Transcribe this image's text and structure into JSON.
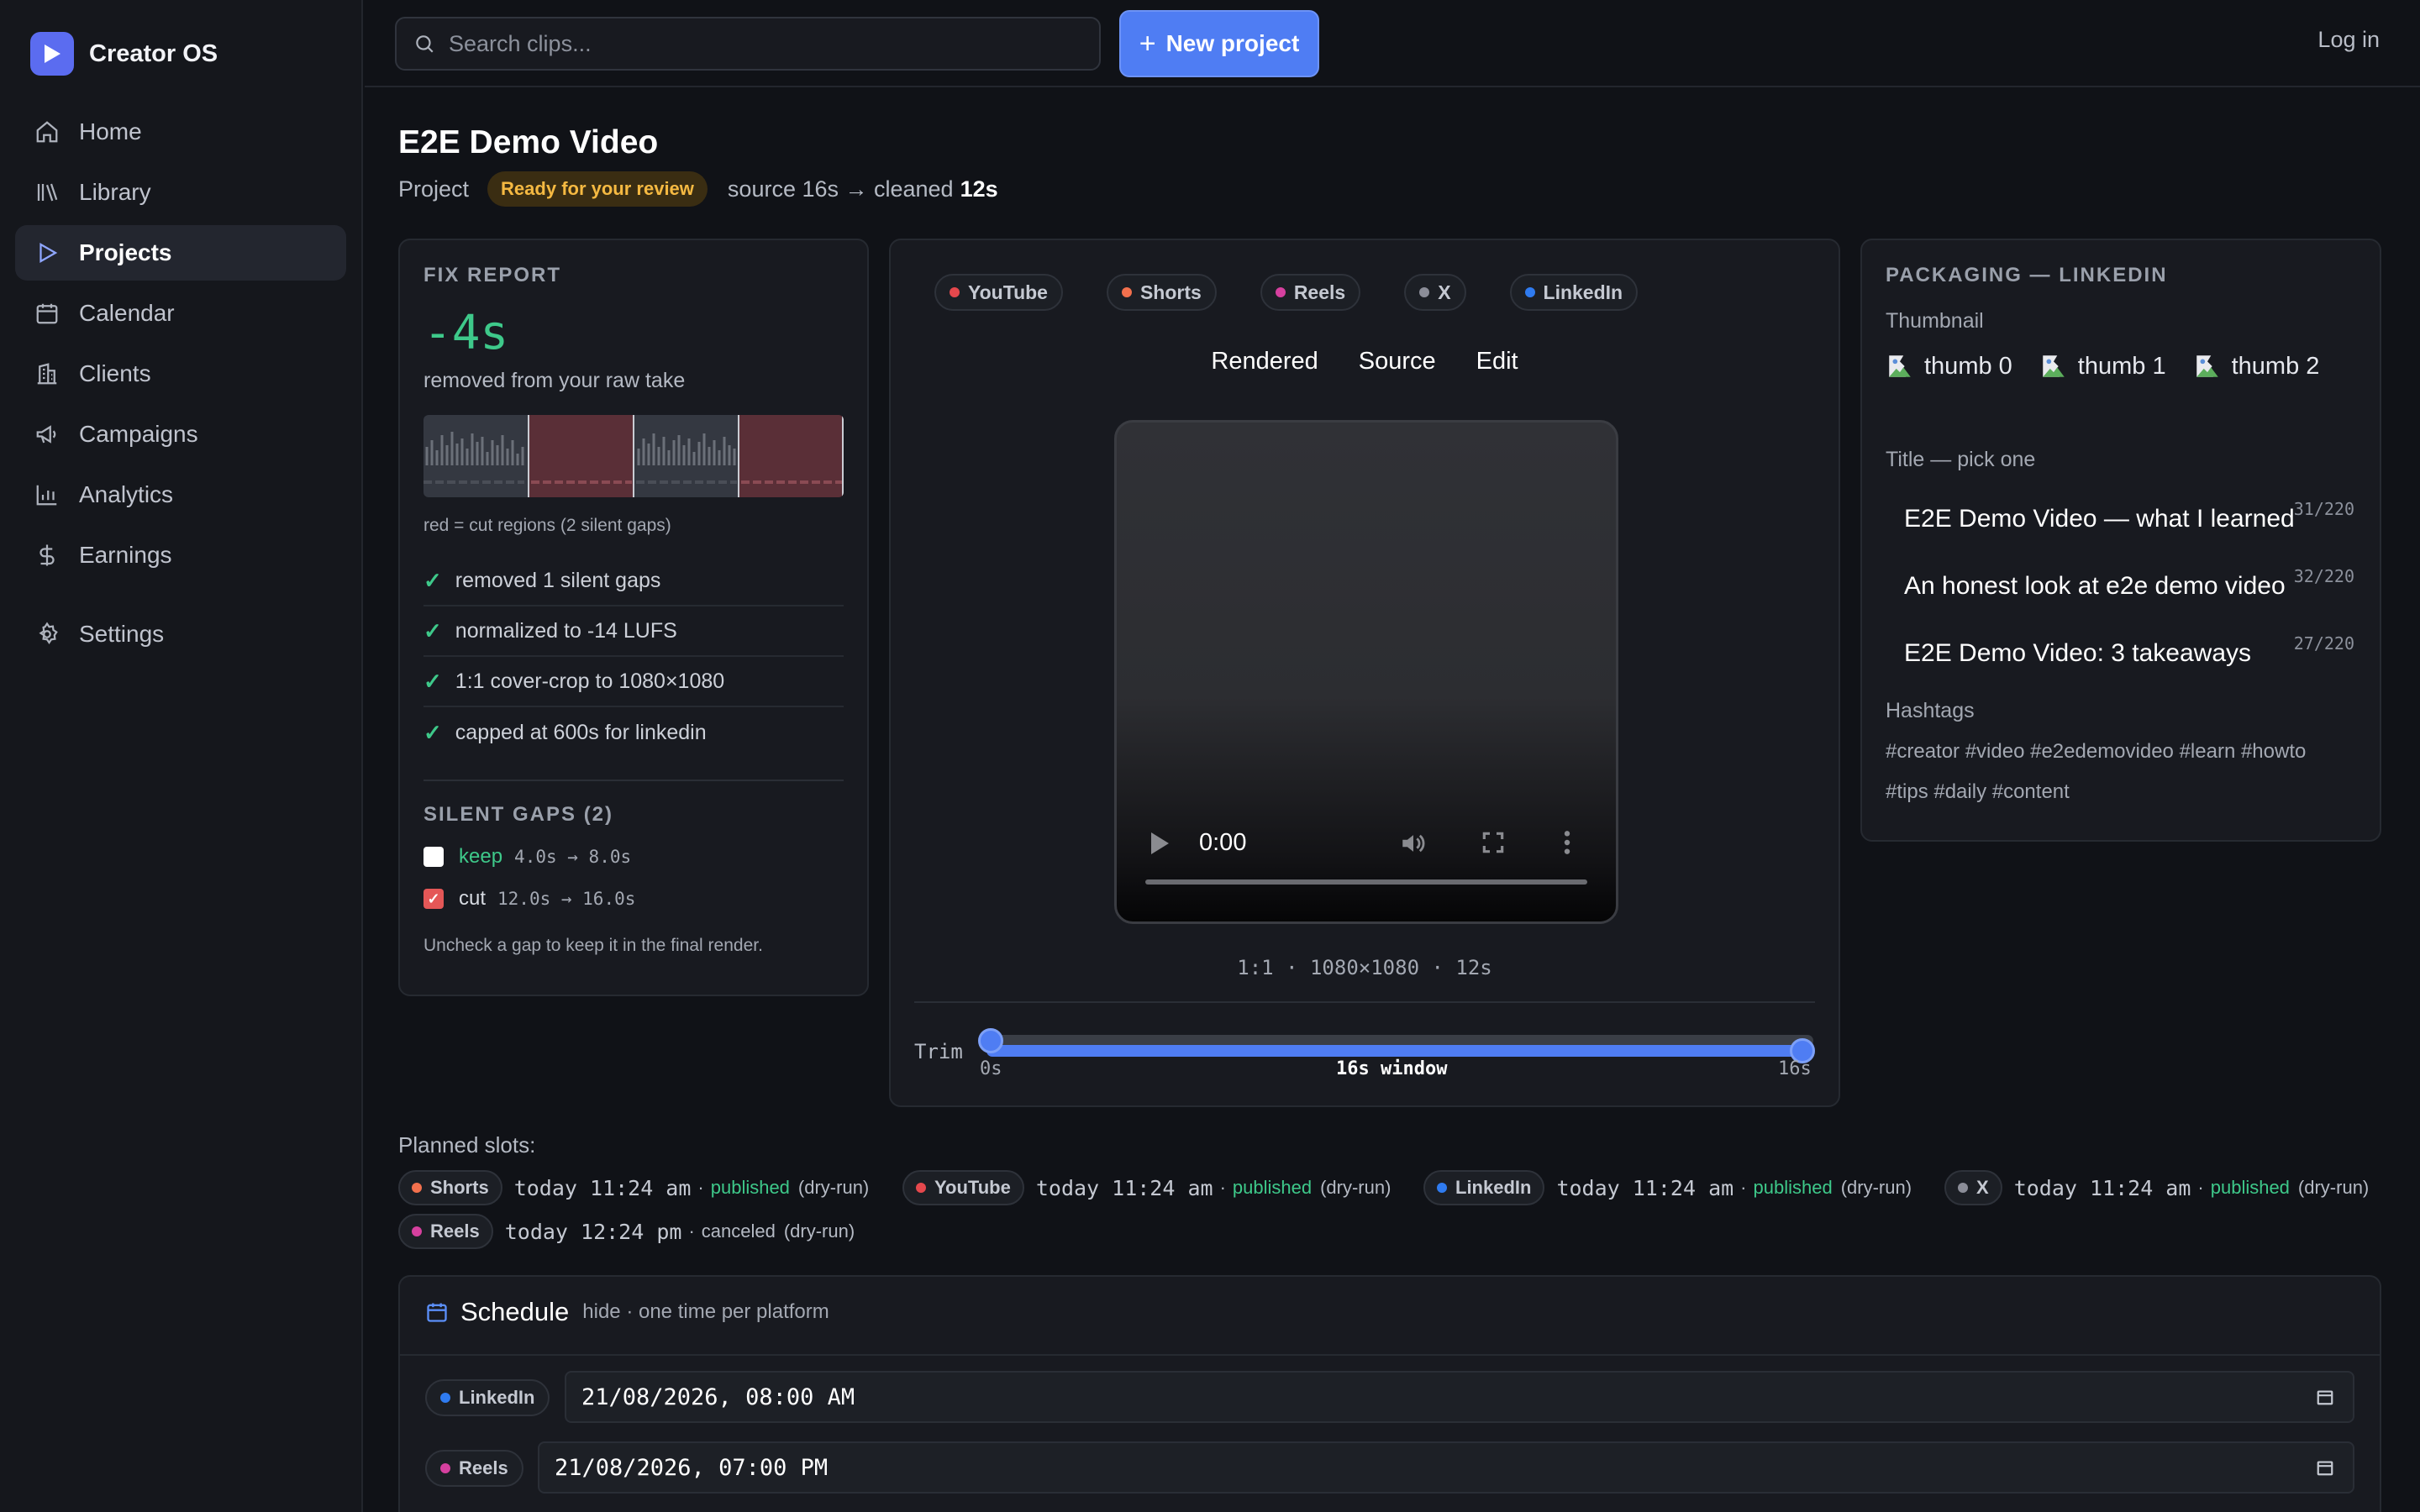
{
  "app": {
    "name": "Creator OS"
  },
  "nav": {
    "home": "Home",
    "library": "Library",
    "projects": "Projects",
    "calendar": "Calendar",
    "clients": "Clients",
    "campaigns": "Campaigns",
    "analytics": "Analytics",
    "earnings": "Earnings",
    "settings": "Settings",
    "active": "Projects"
  },
  "topbar": {
    "search_placeholder": "Search clips...",
    "new_project": "New project",
    "login": "Log in"
  },
  "project": {
    "title": "E2E Demo Video",
    "kind": "Project",
    "status": "Ready for your review",
    "duration_text": "source 16s → cleaned",
    "cleaned": "12s"
  },
  "fix_report": {
    "heading": "FIX REPORT",
    "delta": "-4s",
    "delta_sub": "removed from your raw take",
    "wave_caption": "red = cut regions (2 silent gaps)",
    "checks": [
      "removed 1 silent gaps",
      "normalized to -14 LUFS",
      "1:1 cover-crop to 1080×1080",
      "capped at 600s for linkedin"
    ],
    "gaps_heading": "SILENT GAPS (2)",
    "gaps": [
      {
        "state": "keep",
        "range": "4.0s → 8.0s",
        "checked": false
      },
      {
        "state": "cut",
        "range": "12.0s → 16.0s",
        "checked": true
      }
    ],
    "gap_note": "Uncheck a gap to keep it in the final render."
  },
  "video": {
    "platforms": [
      {
        "name": "YouTube",
        "color": "#e5484d"
      },
      {
        "name": "Shorts",
        "color": "#f2704d"
      },
      {
        "name": "Reels",
        "color": "#d6409f"
      },
      {
        "name": "X",
        "color": "#8b8d98"
      },
      {
        "name": "LinkedIn",
        "color": "#2f7bf0"
      }
    ],
    "tabs": [
      "Rendered",
      "Source",
      "Edit"
    ],
    "player_time": "0:00",
    "caption": "1:1 · 1080×1080 · 12s",
    "trim_label": "Trim",
    "trim_start": "0s",
    "trim_window": "16s window",
    "trim_end": "16s"
  },
  "packaging": {
    "heading": "PACKAGING — LINKEDIN",
    "thumb_label": "Thumbnail",
    "thumbs": [
      "thumb 0",
      "thumb 1",
      "thumb 2"
    ],
    "title_label": "Title — pick one",
    "titles": [
      {
        "text": "E2E Demo Video — what I learned",
        "count": "31/220"
      },
      {
        "text": "An honest look at e2e demo video",
        "count": "32/220"
      },
      {
        "text": "E2E Demo Video: 3 takeaways",
        "count": "27/220"
      }
    ],
    "hashtags_label": "Hashtags",
    "hashtags_line1": "#creator #video #e2edemovideo #learn #howto",
    "hashtags_line2": "#tips #daily #content"
  },
  "planned": {
    "label": "Planned slots:",
    "slots": [
      {
        "platform": "Shorts",
        "color": "#f2704d",
        "when": "today 11:24 am",
        "status": "published",
        "note": "(dry-run)"
      },
      {
        "platform": "YouTube",
        "color": "#e5484d",
        "when": "today 11:24 am",
        "status": "published",
        "note": "(dry-run)"
      },
      {
        "platform": "LinkedIn",
        "color": "#2f7bf0",
        "when": "today 11:24 am",
        "status": "published",
        "note": "(dry-run)"
      },
      {
        "platform": "X",
        "color": "#8b8d98",
        "when": "today 11:24 am",
        "status": "published",
        "note": "(dry-run)"
      },
      {
        "platform": "Reels",
        "color": "#d6409f",
        "when": "today 12:24 pm",
        "status": "canceled",
        "note": "(dry-run)"
      }
    ]
  },
  "schedule": {
    "title": "Schedule",
    "subtitle": "hide · one time per platform",
    "rows": [
      {
        "platform": "LinkedIn",
        "color": "#2f7bf0",
        "value": "21/08/2026, 08:00 AM"
      },
      {
        "platform": "Reels",
        "color": "#d6409f",
        "value": "21/08/2026, 07:00 PM"
      }
    ]
  },
  "colors": {
    "accent": "#4f7df3",
    "success": "#3ec98a",
    "warning": "#f5b942",
    "danger": "#e45757"
  }
}
